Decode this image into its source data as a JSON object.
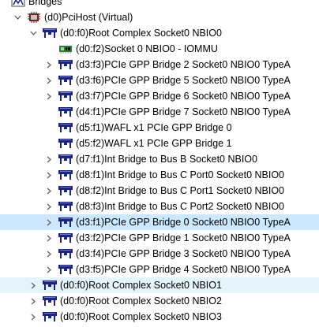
{
  "tree": {
    "root": {
      "label": "Bridges"
    },
    "pcihost": {
      "label": "(d0)PciHost (Virtual)"
    },
    "complex0": {
      "label": "(d0:f0)Root Complex Socket0 NBIO0"
    },
    "children": [
      {
        "label": "(d0:f2)Socket 0 NBIO0 - IOMMU",
        "icon": "iommu-chip-icon",
        "expandable": false
      },
      {
        "label": "(d3:f3)PCIe GPP Bridge 2 Socket0 NBIO0 TypeA",
        "icon": "pci-bridge-icon",
        "expandable": true
      },
      {
        "label": "(d3:f6)PCIe GPP Bridge 5 Socket0 NBIO0 TypeA",
        "icon": "pci-bridge-icon",
        "expandable": true
      },
      {
        "label": "(d3:f7)PCIe GPP Bridge 6 Socket0 NBIO0 TypeA",
        "icon": "pci-bridge-icon",
        "expandable": true
      },
      {
        "label": "(d4:f1)PCIe GPP Bridge 7 Socket0 NBIO0 TypeA",
        "icon": "pci-bridge-icon",
        "expandable": false
      },
      {
        "label": "(d5:f1)WAFL x1 PCIe GPP Bridge 0",
        "icon": "pci-bridge-icon",
        "expandable": false
      },
      {
        "label": "(d5:f2)WAFL x1 PCIe GPP Bridge 1",
        "icon": "pci-bridge-icon",
        "expandable": false
      },
      {
        "label": "(d7:f1)Int Bridge to Bus B Socket0 NBIO0",
        "icon": "pci-bridge-icon",
        "expandable": true
      },
      {
        "label": "(d8:f1)Int Bridge to Bus C Port0 Socket0 NBIO0",
        "icon": "pci-bridge-icon",
        "expandable": true
      },
      {
        "label": "(d8:f2)Int Bridge to Bus C Port1 Socket0 NBIO0",
        "icon": "pci-bridge-icon",
        "expandable": true
      },
      {
        "label": "(d8:f3)Int Bridge to Bus C Port2 Socket0 NBIO0",
        "icon": "pci-bridge-icon",
        "expandable": true
      },
      {
        "label": "(d3:f1)PCIe GPP Bridge 0 Socket0 NBIO0 TypeA",
        "icon": "pci-bridge-icon",
        "expandable": true,
        "selected": true
      },
      {
        "label": "(d3:f2)PCIe GPP Bridge 1 Socket0 NBIO0 TypeA",
        "icon": "pci-bridge-icon",
        "expandable": true
      },
      {
        "label": "(d3:f4)PCIe GPP Bridge 3 Socket0 NBIO0 TypeA",
        "icon": "pci-bridge-icon",
        "expandable": true
      },
      {
        "label": "(d3:f5)PCIe GPP Bridge 4 Socket0 NBIO0 TypeA",
        "icon": "pci-bridge-icon",
        "expandable": true
      }
    ],
    "siblings": [
      {
        "label": "(d0:f0)Root Complex Socket0 NBIO1",
        "hover": true
      },
      {
        "label": "(d0:f0)Root Complex Socket0 NBIO2"
      },
      {
        "label": "(d0:f0)Root Complex Socket0 NBIO3"
      }
    ]
  },
  "colors": {
    "selected_bg": "#cce8ff",
    "hover_bg": "#e5f3fb",
    "chevron": "#606060",
    "bridge_icon_fill": "#1a237e"
  }
}
